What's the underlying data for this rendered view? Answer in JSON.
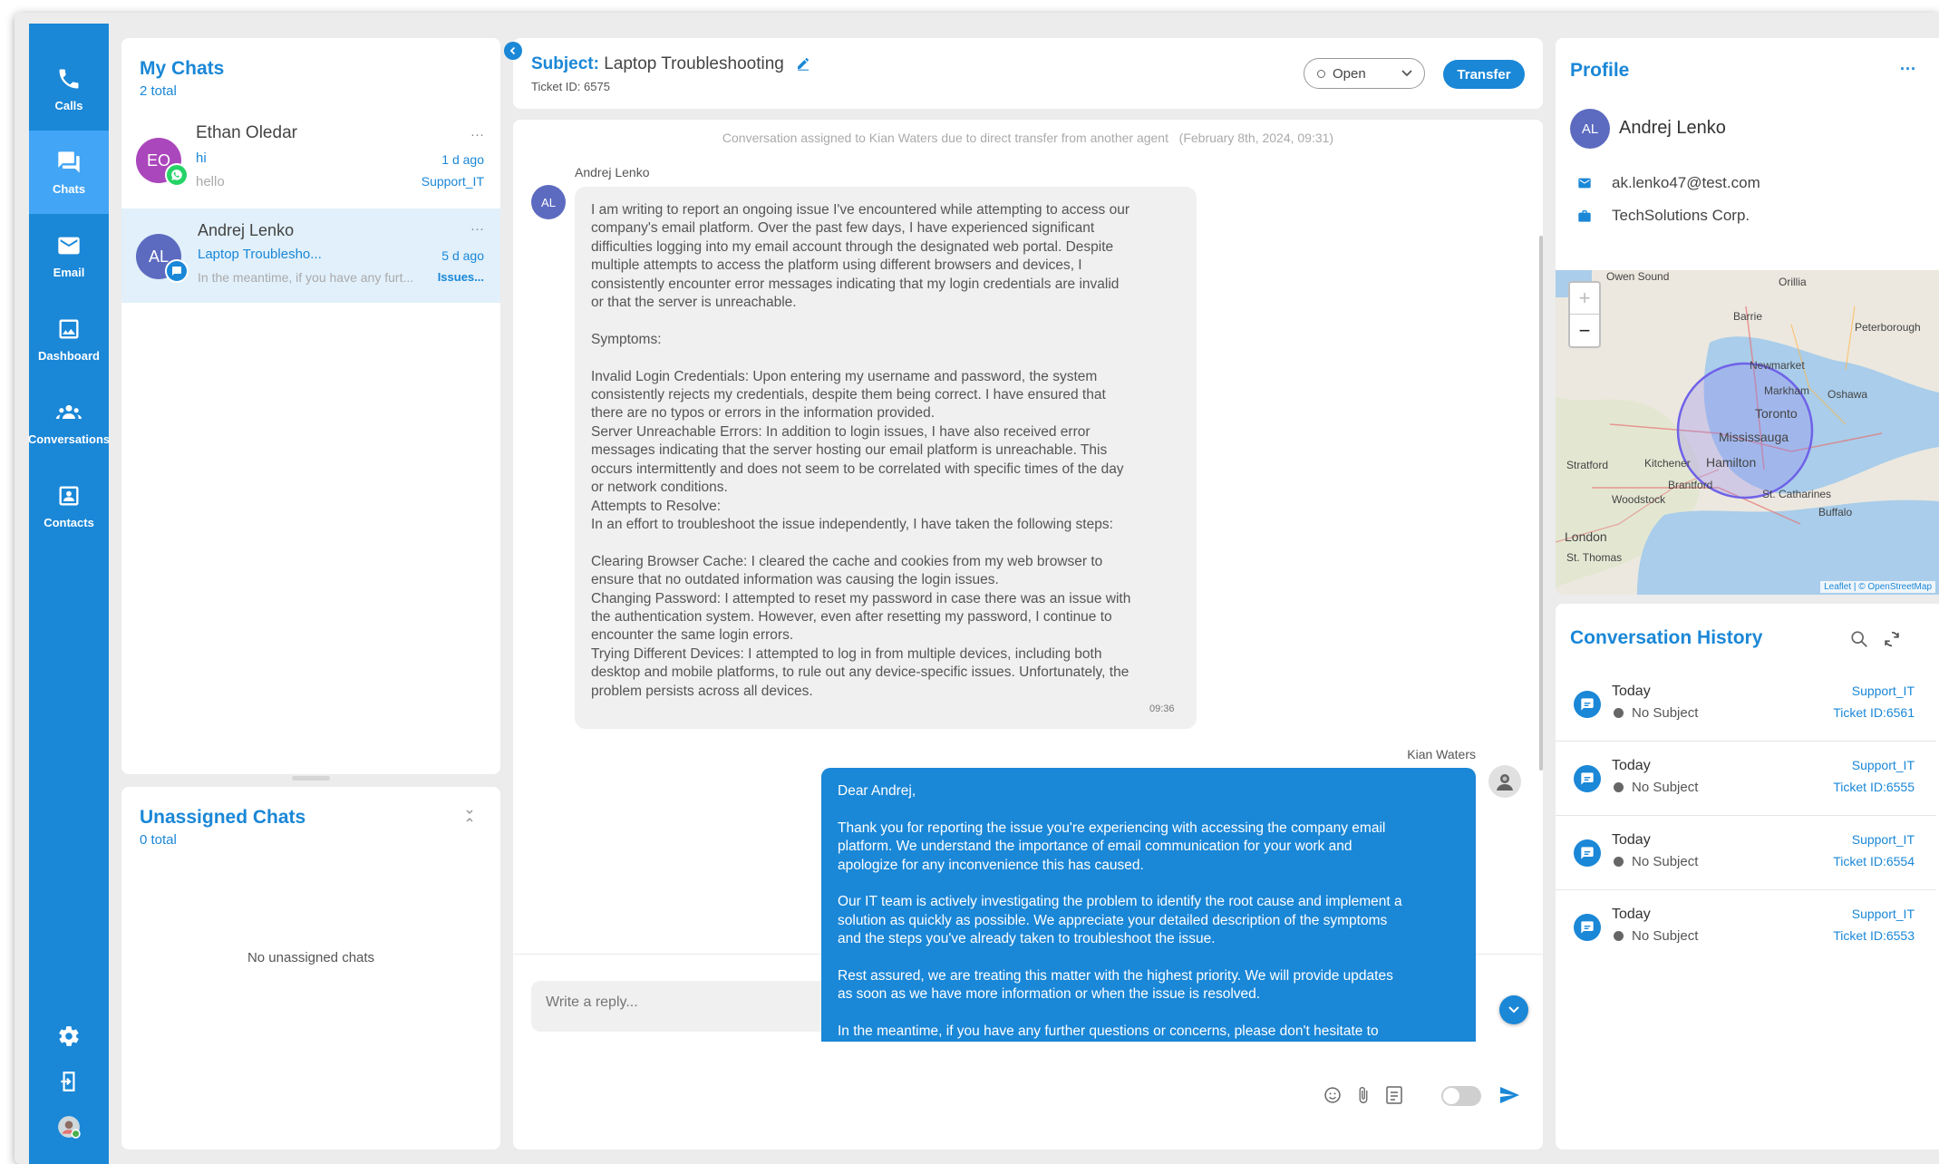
{
  "nav": {
    "items": [
      {
        "label": "Calls",
        "icon": "phone-icon"
      },
      {
        "label": "Chats",
        "icon": "chat-icon"
      },
      {
        "label": "Email",
        "icon": "email-icon"
      },
      {
        "label": "Dashboard",
        "icon": "image-icon"
      },
      {
        "label": "Conversations",
        "icon": "group-icon"
      },
      {
        "label": "Contacts",
        "icon": "contact-card-icon"
      }
    ],
    "bottom_icons": [
      "settings-icon",
      "logout-icon",
      "user-avatar-icon"
    ]
  },
  "my_chats": {
    "title": "My Chats",
    "count": "2 total",
    "items": [
      {
        "initials": "EO",
        "name": "Ethan Oledar",
        "more": "···",
        "subject": "hi",
        "time": "1 d ago",
        "preview": "hello",
        "queue": "Support_IT",
        "channel_icon": "whatsapp-icon"
      },
      {
        "initials": "AL",
        "name": "Andrej Lenko",
        "more": "···",
        "subject": "Laptop Troublesho...",
        "time": "5 d ago",
        "preview": "In the meantime, if you have any furt...",
        "queue": "Issues...",
        "channel_icon": "webchat-icon"
      }
    ]
  },
  "unassigned": {
    "title": "Unassigned Chats",
    "count": "0 total",
    "empty_text": "No unassigned chats"
  },
  "conversation": {
    "subject_label": "Subject:",
    "subject": "Laptop Troubleshooting",
    "ticket": "Ticket ID: 6575",
    "status": "Open",
    "transfer_label": "Transfer",
    "system_message": "Conversation assigned to Kian Waters due to direct transfer from another agent",
    "system_time": "(February 8th, 2024, 09:31)",
    "incoming": {
      "sender": "Andrej Lenko",
      "initials": "AL",
      "text": "I am writing to report an ongoing issue I've encountered while attempting to access our\ncompany's email platform. Over the past few days, I have experienced significant\ndifficulties logging into my email account through the designated web portal. Despite\nmultiple attempts to access the platform using different browsers and devices, I\nconsistently encounter error messages indicating that my login credentials are invalid\nor that the server is unreachable.\n\nSymptoms:\n\nInvalid Login Credentials: Upon entering my username and password, the system\nconsistently rejects my credentials, despite them being correct. I have ensured that\nthere are no typos or errors in the information provided.\nServer Unreachable Errors: In addition to login issues, I have also received error\nmessages indicating that the server hosting our email platform is unreachable. This\noccurs intermittently and does not seem to be correlated with specific times of the day\nor network conditions.\nAttempts to Resolve:\nIn an effort to troubleshoot the issue independently, I have taken the following steps:\n\nClearing Browser Cache: I cleared the cache and cookies from my web browser to\nensure that no outdated information was causing the login issues.\nChanging Password: I attempted to reset my password in case there was an issue with\nthe authentication system. However, even after resetting my password, I continue to\nencounter the same login errors.\nTrying Different Devices: I attempted to log in from multiple devices, including both\ndesktop and mobile platforms, to rule out any device-specific issues. Unfortunately, the\nproblem persists across all devices.",
      "time": "09:36"
    },
    "outgoing": {
      "sender": "Kian Waters",
      "text": "Dear Andrej,\n\nThank you for reporting the issue you're experiencing with accessing the company email\nplatform. We understand the importance of email communication for your work and\napologize for any inconvenience this has caused.\n\nOur IT team is actively investigating the problem to identify the root cause and implement a\nsolution as quickly as possible. We appreciate your detailed description of the symptoms\nand the steps you've already taken to troubleshoot the issue.\n\nRest assured, we are treating this matter with the highest priority. We will provide updates\nas soon as we have more information or when the issue is resolved.\n\nIn the meantime, if you have any further questions or concerns, please don't hesitate to\nreach out."
    },
    "reply_placeholder": "Write a reply..."
  },
  "profile": {
    "title": "Profile",
    "more": "···",
    "initials": "AL",
    "name": "Andrej Lenko",
    "email": "ak.lenko47@test.com",
    "company": "TechSolutions Corp."
  },
  "map": {
    "zoom_in": "+",
    "zoom_out": "−",
    "attribution": "Leaflet | © OpenStreetMap",
    "places": [
      "Owen Sound",
      "Orillia",
      "Barrie",
      "Peterborough",
      "Newmarket",
      "Markham",
      "Oshawa",
      "Toronto",
      "Mississauga",
      "Stratford",
      "Kitchener",
      "Hamilton",
      "Brantford",
      "Woodstock",
      "St. Catharines",
      "Buffalo",
      "London",
      "St. Thomas"
    ]
  },
  "history": {
    "title": "Conversation History",
    "items": [
      {
        "day": "Today",
        "subject": "No Subject",
        "dept": "Support_IT",
        "ticket": "Ticket ID:6561"
      },
      {
        "day": "Today",
        "subject": "No Subject",
        "dept": "Support_IT",
        "ticket": "Ticket ID:6555"
      },
      {
        "day": "Today",
        "subject": "No Subject",
        "dept": "Support_IT",
        "ticket": "Ticket ID:6554"
      },
      {
        "day": "Today",
        "subject": "No Subject",
        "dept": "Support_IT",
        "ticket": "Ticket ID:6553"
      }
    ]
  },
  "colors": {
    "brand": "#1a87d7",
    "nav_active": "#42a5f5",
    "incoming_bubble": "#f0f0f0",
    "avatar": "#5c6bc0"
  }
}
